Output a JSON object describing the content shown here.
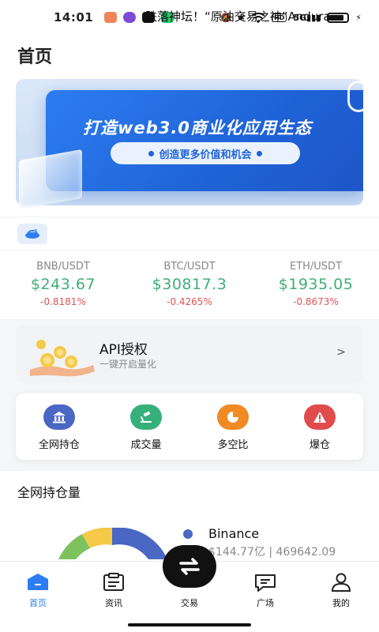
{
  "status_bar": {
    "time": "14:01",
    "hd_label": "HD",
    "network_label": "5G"
  },
  "page": {
    "title": "首页"
  },
  "banner": {
    "headline": "打造web3.0商业化应用生态",
    "subline": "创造更多价值和机会"
  },
  "news": {
    "headline": "跌落神坛！“原油交易之神”Andura"
  },
  "tickers": [
    {
      "pair": "BNB/USDT",
      "price": "$243.67",
      "change": "-0.8181%"
    },
    {
      "pair": "BTC/USDT",
      "price": "$30817.3",
      "change": "-0.4265%"
    },
    {
      "pair": "ETH/USDT",
      "price": "$1935.05",
      "change": "-0.8673%"
    }
  ],
  "api_card": {
    "title": "API授权",
    "subtitle": "一键开启量化",
    "chevron": ">"
  },
  "actions": [
    {
      "label": "全网持仓",
      "icon": "bank-icon",
      "color": "#4a67c4"
    },
    {
      "label": "成交量",
      "icon": "gavel-icon",
      "color": "#35b07a"
    },
    {
      "label": "多空比",
      "icon": "pie-icon",
      "color": "#f08a22"
    },
    {
      "label": "爆仓",
      "icon": "warning-icon",
      "color": "#e14b4b"
    }
  ],
  "holdings": {
    "title": "全网持仓量",
    "legend_name": "Binance",
    "legend_value": "$144.77亿 | 469642.09"
  },
  "bottom_nav": {
    "items": [
      {
        "label": "首页",
        "icon": "home-icon",
        "active": true
      },
      {
        "label": "资讯",
        "icon": "news-icon",
        "active": false
      },
      {
        "label": "交易",
        "icon": "swap-icon",
        "active": false
      },
      {
        "label": "广场",
        "icon": "chat-icon",
        "active": false
      },
      {
        "label": "我的",
        "icon": "profile-icon",
        "active": false
      }
    ]
  },
  "colors": {
    "accent": "#2d7ef2",
    "price_up": "#3fae7a",
    "change_down": "#e05454"
  }
}
